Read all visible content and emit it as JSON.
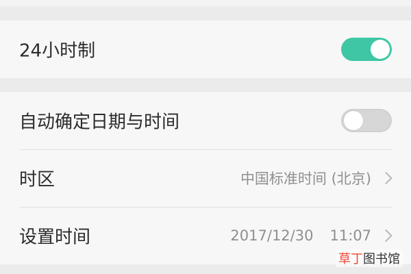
{
  "settings": {
    "group1": [
      {
        "label": "24小时制",
        "toggle": true
      }
    ],
    "group2": {
      "auto_time": {
        "label": "自动确定日期与时间",
        "toggle": false
      },
      "timezone": {
        "label": "时区",
        "value": "中国标准时间 (北京)"
      },
      "set_time": {
        "label": "设置时间",
        "date": "2017/12/30",
        "time": "11:07"
      }
    }
  },
  "watermark": {
    "part1": "草丁",
    "part2": "图书馆"
  },
  "colors": {
    "toggle_on": "#3fc6a4",
    "toggle_off": "#d7d7d7",
    "background": "#ebebeb",
    "card": "#f7f7f7"
  },
  "icons": {
    "chevron": "chevron-right-icon"
  }
}
